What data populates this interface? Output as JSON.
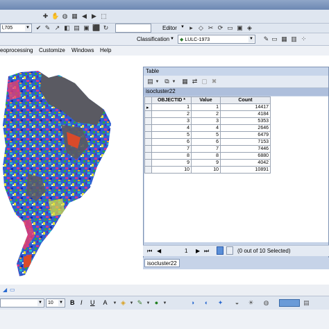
{
  "toolbar": {
    "scale_value": "l,705",
    "editor_label": "Editor",
    "classification_label": "Classification",
    "layer_combo": "LULC-1973"
  },
  "menu": {
    "items": [
      "eoprocessing",
      "Customize",
      "Windows",
      "Help"
    ]
  },
  "table_window": {
    "title": "Table",
    "layer_name": "isocluster22",
    "columns": [
      "OBJECTID *",
      "Value",
      "Count"
    ],
    "rows": [
      [
        "1",
        "1",
        "14417"
      ],
      [
        "2",
        "2",
        "4184"
      ],
      [
        "3",
        "3",
        "5353"
      ],
      [
        "4",
        "4",
        "2646"
      ],
      [
        "5",
        "5",
        "6479"
      ],
      [
        "6",
        "6",
        "7153"
      ],
      [
        "7",
        "7",
        "7446"
      ],
      [
        "8",
        "8",
        "6880"
      ],
      [
        "9",
        "9",
        "4042"
      ],
      [
        "10",
        "10",
        "10891"
      ]
    ],
    "record_number": "1",
    "selection_status": "(0 out of 10 Selected)",
    "tab_label": "isocluster22"
  },
  "draw_toolbar": {
    "font_size": "10",
    "bold": "B",
    "italic": "I",
    "underline": "U"
  },
  "colors": {
    "window_frame": "#c6d3e8",
    "layer_header": "#aebfdc",
    "toolbar_bg": "#dfe6f0"
  }
}
